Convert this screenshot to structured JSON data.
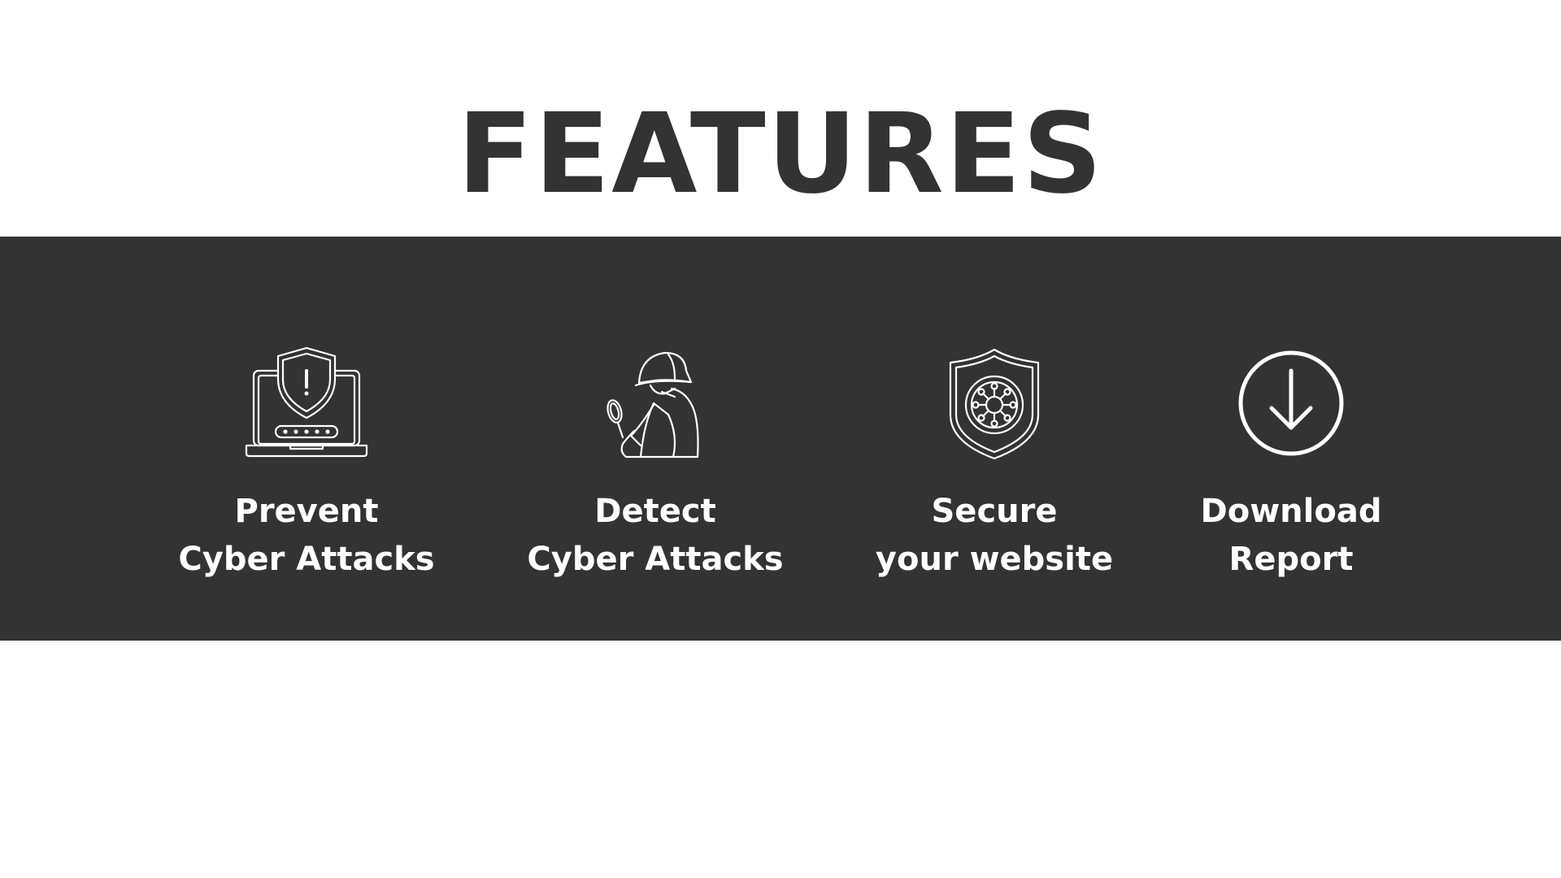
{
  "heading": "FEATURES",
  "colors": {
    "band": "#333333",
    "title": "#333333",
    "feature_text": "#ffffff",
    "background": "#ffffff"
  },
  "features": [
    {
      "icon": "laptop-shield-icon",
      "line1": "Prevent",
      "line2": "Cyber Attacks"
    },
    {
      "icon": "detective-magnifier-icon",
      "line1": "Detect",
      "line2": "Cyber Attacks"
    },
    {
      "icon": "shield-virus-icon",
      "line1": "Secure",
      "line2": "your website"
    },
    {
      "icon": "download-circle-icon",
      "line1": "Download",
      "line2": "Report"
    }
  ]
}
